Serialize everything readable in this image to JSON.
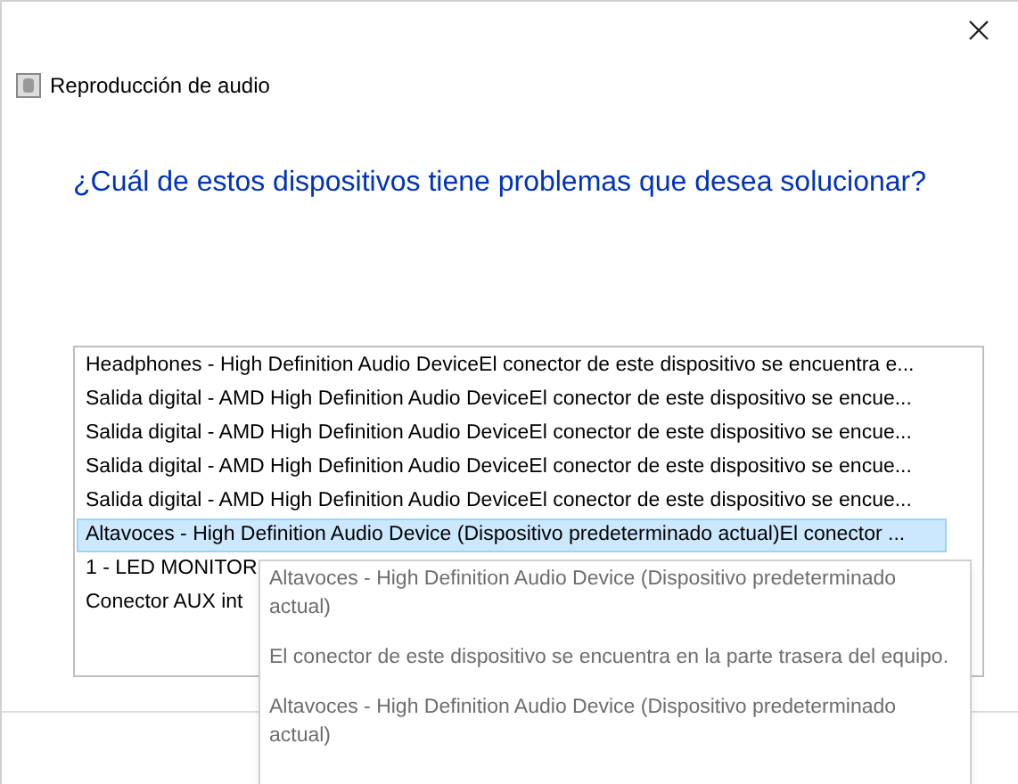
{
  "window": {
    "title": "Reproducción de audio"
  },
  "heading": "¿Cuál de estos dispositivos tiene problemas que desea solucionar?",
  "devices": [
    {
      "label": "Headphones - High Definition Audio DeviceEl conector de este dispositivo se encuentra e...",
      "selected": false
    },
    {
      "label": "Salida digital - AMD High Definition Audio DeviceEl conector de este dispositivo se encue...",
      "selected": false
    },
    {
      "label": "Salida digital - AMD High Definition Audio DeviceEl conector de este dispositivo se encue...",
      "selected": false
    },
    {
      "label": "Salida digital - AMD High Definition Audio DeviceEl conector de este dispositivo se encue...",
      "selected": false
    },
    {
      "label": "Salida digital - AMD High Definition Audio DeviceEl conector de este dispositivo se encue...",
      "selected": false
    },
    {
      "label": "Altavoces - High Definition Audio Device (Dispositivo predeterminado actual)El conector ...",
      "selected": true
    },
    {
      "label": "1 - LED MONITOR",
      "selected": false
    },
    {
      "label": "Conector AUX int",
      "selected": false
    }
  ],
  "tooltip": [
    "Altavoces - High Definition Audio Device (Dispositivo predeterminado actual)",
    "El conector de este dispositivo se encuentra en la parte trasera del equipo.",
    "Altavoces - High Definition Audio Device (Dispositivo predeterminado actual)"
  ]
}
